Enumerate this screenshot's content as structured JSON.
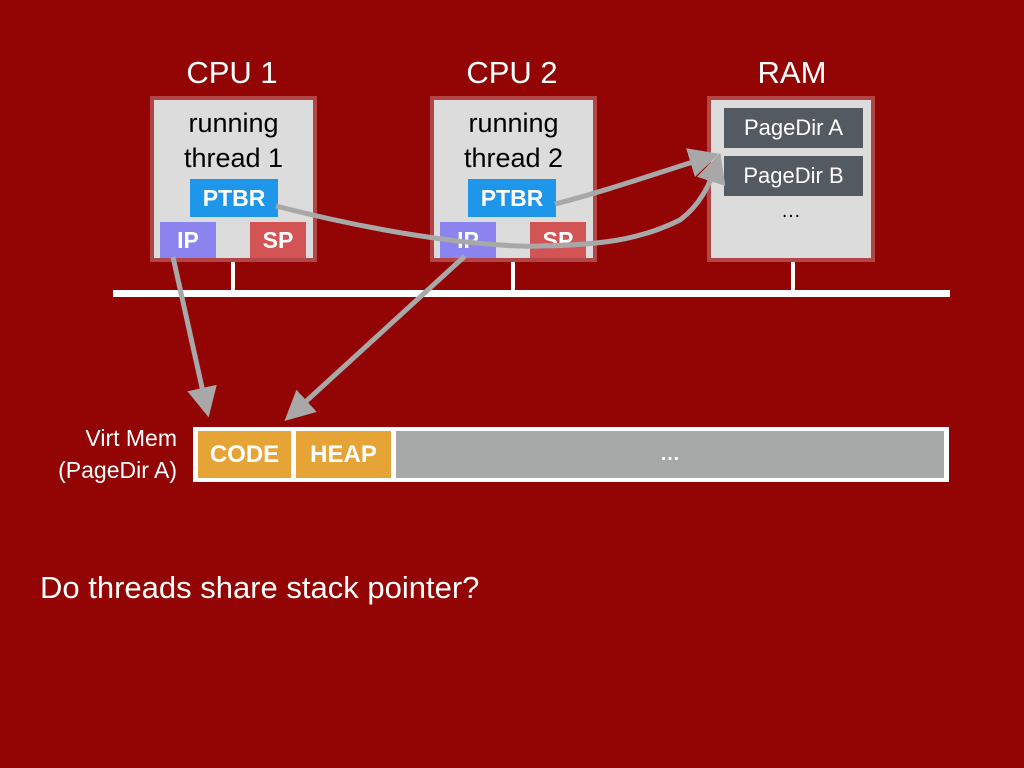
{
  "slide": {
    "question": "Do threads share stack pointer?"
  },
  "cpus": [
    {
      "heading": "CPU 1",
      "status_line1": "running",
      "status_line2": "thread 1",
      "registers": {
        "ptbr": "PTBR",
        "ip": "IP",
        "sp": "SP"
      }
    },
    {
      "heading": "CPU 2",
      "status_line1": "running",
      "status_line2": "thread 2",
      "registers": {
        "ptbr": "PTBR",
        "ip": "IP",
        "sp": "SP"
      }
    }
  ],
  "ram": {
    "heading": "RAM",
    "entries": [
      "PageDir A",
      "PageDir B"
    ],
    "ellipsis": "…"
  },
  "virtual_memory": {
    "label_line1": "Virt Mem",
    "label_line2": "(PageDir A)",
    "segments": [
      "CODE",
      "HEAP"
    ],
    "rest_ellipsis": "…"
  },
  "colors": {
    "background": "#930404",
    "ptbr": "#1e96ea",
    "ip": "#8c84ee",
    "sp": "#d25454",
    "pagedir": "#545a62",
    "segment": "#e6a336",
    "segment_rest": "#a7a9a8",
    "arrow": "#a8a8a8"
  }
}
